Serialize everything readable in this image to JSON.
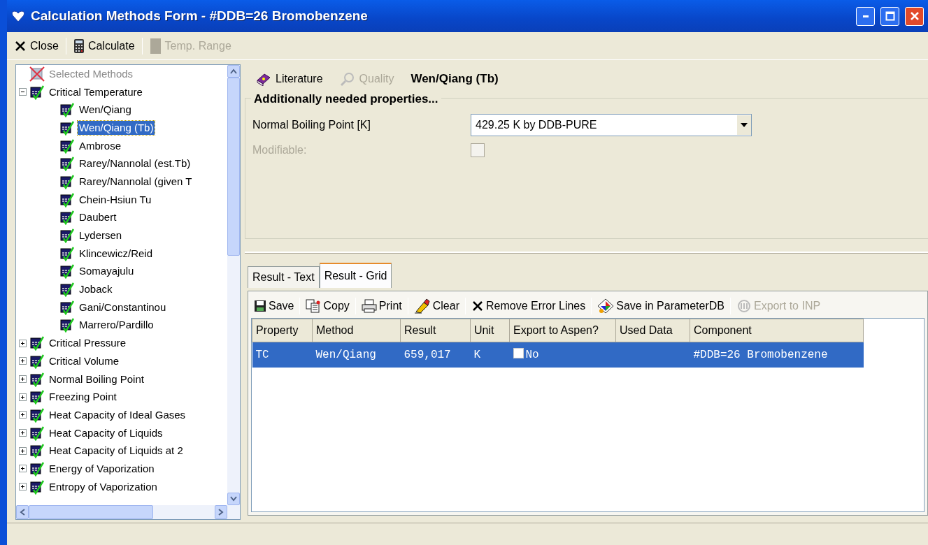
{
  "window": {
    "title": "Calculation Methods Form - #DDB=26 Bromobenzene"
  },
  "toolbar": [
    {
      "label": "Close",
      "disabled": false
    },
    {
      "label": "Calculate",
      "disabled": false
    },
    {
      "label": "Temp. Range",
      "disabled": true
    }
  ],
  "tree": [
    {
      "label": "Selected Methods",
      "kind": "excluded",
      "disabled": true,
      "selected": false
    },
    {
      "label": "Critical Temperature",
      "kind": "method",
      "expanded": true,
      "selected": false,
      "children": [
        {
          "label": "Wen/Qiang",
          "selected": false
        },
        {
          "label": "Wen/Qiang (Tb)",
          "selected": true
        },
        {
          "label": "Ambrose",
          "selected": false
        },
        {
          "label": "Rarey/Nannolal (est.Tb)",
          "selected": false
        },
        {
          "label": "Rarey/Nannolal (given T",
          "selected": false
        },
        {
          "label": "Chein-Hsiun Tu",
          "selected": false
        },
        {
          "label": "Daubert",
          "selected": false
        },
        {
          "label": "Lydersen",
          "selected": false
        },
        {
          "label": "Klincewicz/Reid",
          "selected": false
        },
        {
          "label": "Somayajulu",
          "selected": false
        },
        {
          "label": "Joback",
          "selected": false
        },
        {
          "label": "Gani/Constantinou",
          "selected": false
        },
        {
          "label": "Marrero/Pardillo",
          "selected": false
        }
      ]
    },
    {
      "label": "Critical Pressure",
      "kind": "method",
      "expanded": false,
      "selected": false
    },
    {
      "label": "Critical Volume",
      "kind": "method",
      "expanded": false,
      "selected": false
    },
    {
      "label": "Normal Boiling Point",
      "kind": "method",
      "expanded": false,
      "selected": false
    },
    {
      "label": "Freezing Point",
      "kind": "method",
      "expanded": false,
      "selected": false
    },
    {
      "label": "Heat Capacity of Ideal Gases",
      "kind": "method",
      "expanded": false,
      "selected": false
    },
    {
      "label": "Heat Capacity of Liquids",
      "kind": "method",
      "expanded": false,
      "selected": false
    },
    {
      "label": "Heat Capacity of Liquids at 2",
      "kind": "method",
      "expanded": false,
      "selected": false
    },
    {
      "label": "Energy of Vaporization",
      "kind": "method",
      "expanded": false,
      "selected": false
    },
    {
      "label": "Entropy of Vaporization",
      "kind": "method",
      "expanded": false,
      "selected": false
    }
  ],
  "method_bar": {
    "links": [
      {
        "label": "Literature",
        "disabled": false
      },
      {
        "label": "Quality",
        "disabled": true
      }
    ],
    "method_name": "Wen/Qiang (Tb)"
  },
  "properties_group": {
    "title": "Additionally needed properties...",
    "field_label": "Normal Boiling Point [K]",
    "field_value": "429.25 K by DDB-PURE",
    "modifiable_label": "Modifiable:",
    "modifiable_checked": false,
    "disabled": true
  },
  "result_tabs": [
    {
      "label": "Result - Text",
      "selected": false
    },
    {
      "label": "Result - Grid",
      "selected": true
    }
  ],
  "grid_toolbar": [
    {
      "label": "Save",
      "disabled": false
    },
    {
      "label": "Copy",
      "disabled": false
    },
    {
      "label": "Print",
      "disabled": false
    },
    {
      "label": "Clear",
      "disabled": false
    },
    {
      "label": "Remove Error Lines",
      "disabled": false
    },
    {
      "label": "Save in ParameterDB",
      "disabled": false
    },
    {
      "label": "Export to INP",
      "disabled": true
    }
  ],
  "table": {
    "columns": [
      "Property",
      "Method",
      "Result",
      "Unit",
      "Export to Aspen?",
      "Used Data",
      "Component"
    ],
    "rows": [
      {
        "selected": true,
        "export_checked": false,
        "cells": [
          "TC",
          "Wen/Qiang",
          "659,017",
          "K",
          "No",
          "",
          "#DDB=26 Bromobenzene"
        ]
      }
    ]
  }
}
